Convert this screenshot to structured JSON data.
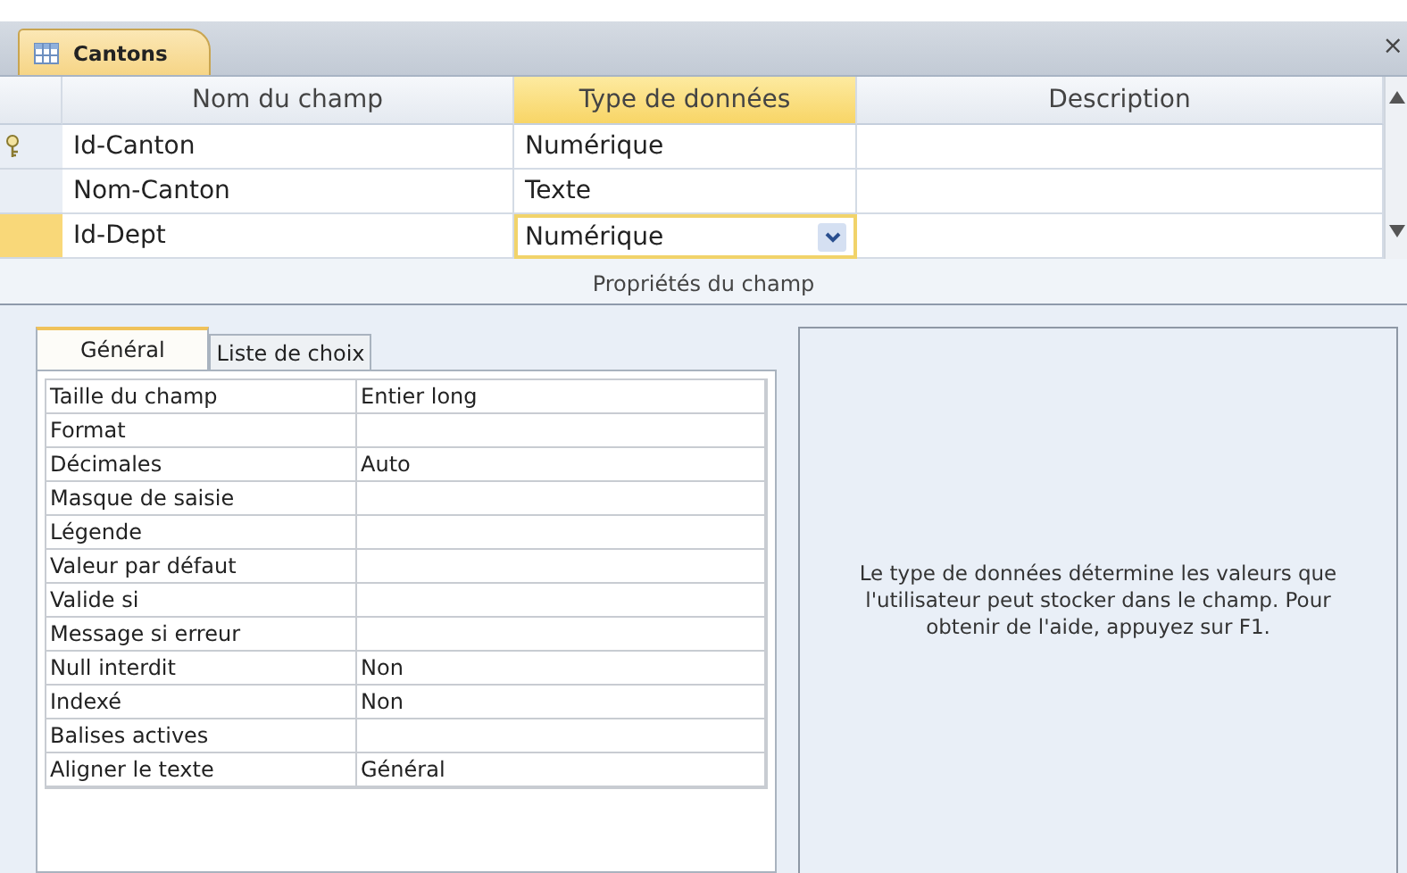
{
  "document_tab": {
    "title": "Cantons",
    "close": "×"
  },
  "columns": [
    "Nom du champ",
    "Type de données",
    "Description"
  ],
  "fields": [
    {
      "name": "Id-Canton",
      "type": "Numérique",
      "primary_key": true,
      "selected": false
    },
    {
      "name": "Nom-Canton",
      "type": "Texte",
      "primary_key": false,
      "selected": false
    },
    {
      "name": "Id-Dept",
      "type": "Numérique",
      "primary_key": false,
      "selected": true
    }
  ],
  "section_title": "Propriétés du champ",
  "property_tabs": [
    {
      "label": "Général",
      "selected": true
    },
    {
      "label": "Liste de choix",
      "selected": false
    }
  ],
  "properties": [
    {
      "label": "Taille du champ",
      "value": "Entier long"
    },
    {
      "label": "Format"
    },
    {
      "label": "Décimales",
      "value": "Auto"
    },
    {
      "label": "Masque de saisie"
    },
    {
      "label": "Légende"
    },
    {
      "label": "Valeur par défaut"
    },
    {
      "label": "Valide si"
    },
    {
      "label": "Message si erreur"
    },
    {
      "label": "Null interdit",
      "value": "Non"
    },
    {
      "label": "Indexé",
      "value": "Non"
    },
    {
      "label": "Balises actives"
    },
    {
      "label": "Aligner le texte",
      "value": "Général"
    }
  ],
  "help_text": "Le type de données détermine les valeurs que l'utilisateur peut stocker dans le champ. Pour obtenir de l'aide, appuyez sur F1."
}
